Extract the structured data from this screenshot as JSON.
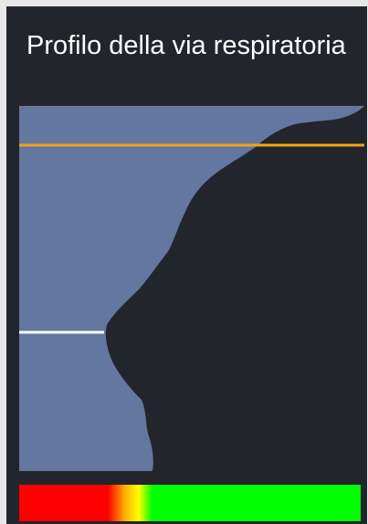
{
  "panel": {
    "title": "Profilo della via respiratoria"
  },
  "profile": {
    "fill_color": "#6477a0",
    "background_color": "#22252c"
  },
  "markers": {
    "upper_line_color": "#f2a21b",
    "lower_line_color": "#ffffff"
  },
  "color_scale": {
    "colors": [
      "#ff0000",
      "#ff0000",
      "#ffb000",
      "#ffff00",
      "#00ff00",
      "#00ff00"
    ]
  }
}
